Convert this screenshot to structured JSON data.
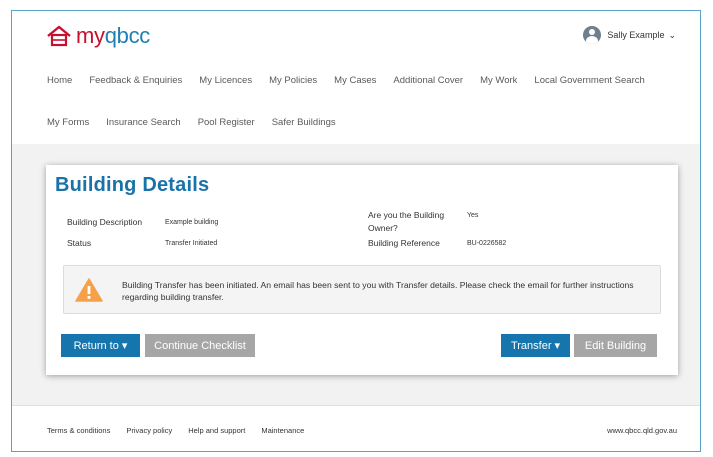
{
  "header": {
    "logo_text_a": "my",
    "logo_text_b": "q",
    "logo_text_c": "bcc",
    "user_name": "Sally Example",
    "nav_row1": [
      "Home",
      "Feedback & Enquiries",
      "My Licences",
      "My Policies",
      "My Cases",
      "Additional Cover",
      "My Work",
      "Local Government Search"
    ],
    "nav_row2": [
      "My Forms",
      "Insurance Search",
      "Pool Register",
      "Safer Buildings"
    ]
  },
  "card": {
    "title": "Building Details",
    "description_label": "Building Description",
    "description_value": "Example building",
    "status_label": "Status",
    "status_value": "Transfer Initiated",
    "owner_label_line1": "Are you the Building",
    "owner_label_line2": "Owner?",
    "owner_value": "Yes",
    "reference_label": "Building Reference",
    "reference_value": "BU-0226582",
    "alert_text": "Building Transfer has been initiated. An email has been sent to you with Transfer details. Please check the email for further instructions regarding building transfer.",
    "buttons": {
      "return_to": "Return to ▾",
      "continue_checklist": "Continue Checklist",
      "transfer": "Transfer ▾",
      "edit_building": "Edit Building"
    }
  },
  "footer": {
    "links": [
      "Terms & conditions",
      "Privacy policy",
      "Help and support",
      "Maintenance"
    ],
    "site": "www.qbcc.qld.gov.au"
  },
  "colors": {
    "brand_red": "#c8102e",
    "brand_blue": "#1a73a8",
    "button_blue": "#1675ad",
    "button_grey": "#a6a6a6",
    "warning_orange": "#f5a14a"
  }
}
